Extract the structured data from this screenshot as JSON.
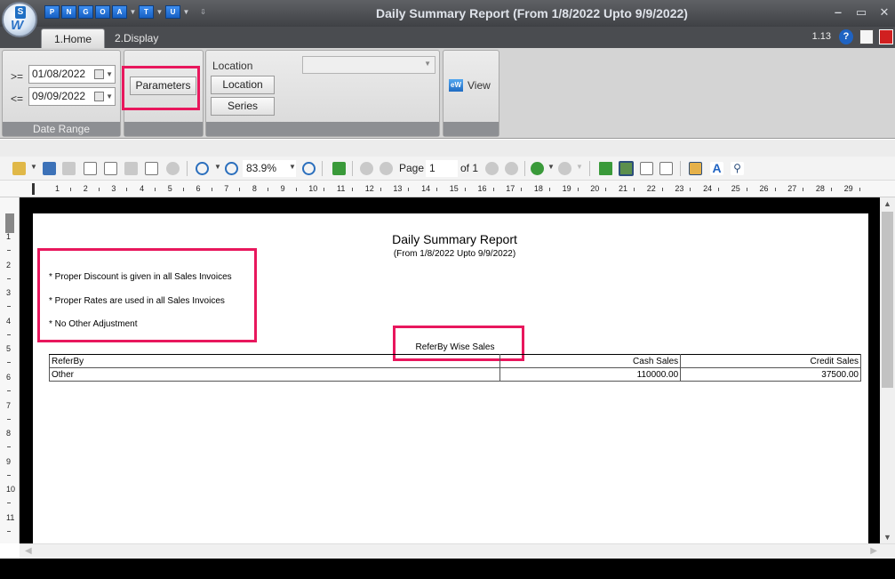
{
  "window": {
    "title": "Daily Summary Report (From 1/8/2022 Upto 9/9/2022)",
    "version": "1.13",
    "controls": {
      "minimize": "‒",
      "maximize": "▭",
      "close": "✕"
    }
  },
  "quick_access": [
    {
      "label": "P",
      "icon": "p-icon"
    },
    {
      "label": "N",
      "icon": "n-icon"
    },
    {
      "label": "G",
      "icon": "g-icon"
    },
    {
      "label": "O",
      "icon": "o-icon"
    },
    {
      "label": "A",
      "icon": "a-icon"
    },
    {
      "label": "T",
      "icon": "t-icon"
    },
    {
      "label": "U",
      "icon": "u-icon"
    }
  ],
  "tabs": [
    {
      "label": "1.Home",
      "active": true
    },
    {
      "label": "2.Display",
      "active": false
    }
  ],
  "ribbon": {
    "date_range": {
      "from_operator": ">=",
      "from_value": "01/08/2022",
      "to_operator": "<=",
      "to_value": "09/09/2022",
      "group_label": "Date Range"
    },
    "parameters_label": "Parameters",
    "location": {
      "label": "Location",
      "location_button": "Location",
      "series_button": "Series",
      "combo_value": ""
    },
    "view_label": "View"
  },
  "toolbar": {
    "zoom": "83.9%",
    "page_label": "Page",
    "page_value": "1",
    "of_label": "of 1"
  },
  "rulers": {
    "horizontal": [
      "1",
      "2",
      "3",
      "4",
      "5",
      "6",
      "7",
      "8",
      "9",
      "10",
      "11",
      "12",
      "13",
      "14",
      "15",
      "16",
      "17",
      "18",
      "19",
      "20",
      "21",
      "22",
      "23",
      "24",
      "25",
      "26",
      "27",
      "28",
      "29"
    ],
    "vertical": [
      "1",
      "2",
      "3",
      "4",
      "5",
      "6",
      "7",
      "8",
      "9",
      "10",
      "11"
    ]
  },
  "report": {
    "title": "Daily Summary Report",
    "subtitle": "(From 1/8/2022 Upto 9/9/2022)",
    "notes": [
      "* Proper Discount is given in all Sales Invoices",
      "* Proper Rates are used in all Sales Invoices",
      "* No Other Adjustment"
    ],
    "table_title": "ReferBy Wise Sales",
    "columns": [
      "ReferBy",
      "Cash Sales",
      "Credit Sales"
    ],
    "rows": [
      [
        "Other",
        "110000.00",
        "37500.00"
      ]
    ]
  },
  "colors": {
    "highlight": "#e8175d",
    "title_bar": "#4a4c50",
    "ribbon": "#d4d4d4"
  }
}
